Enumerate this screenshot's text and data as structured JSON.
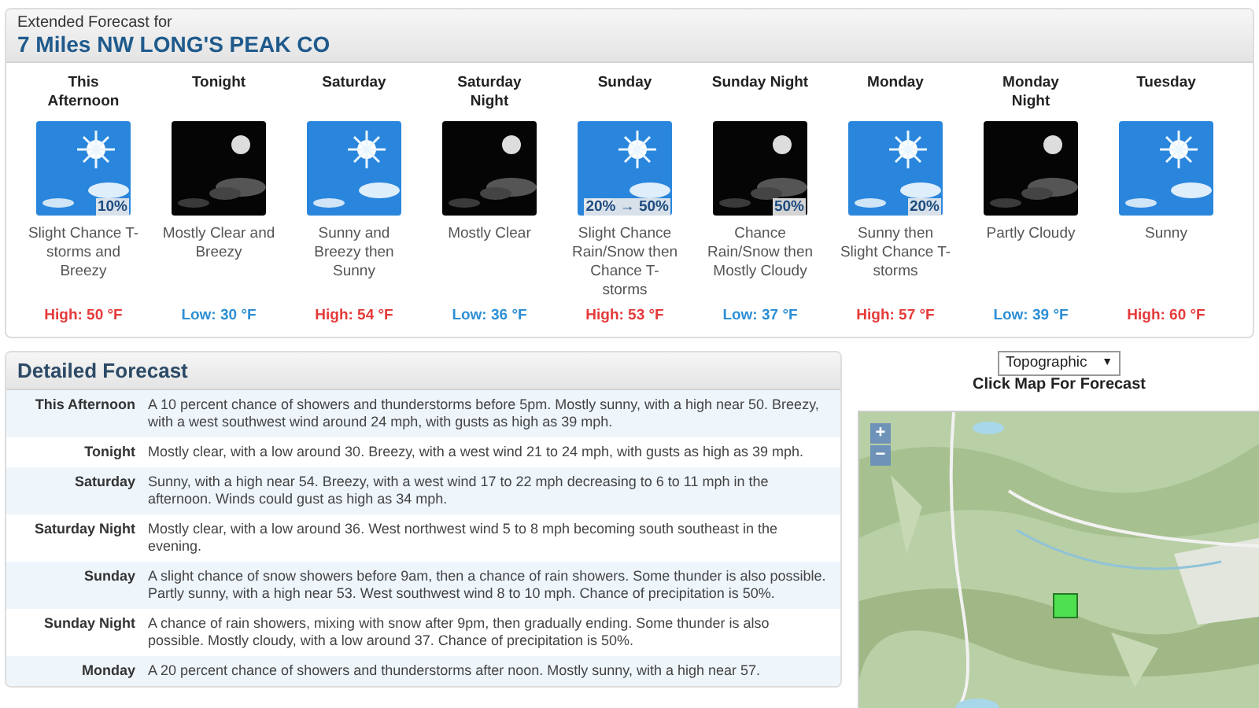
{
  "extended": {
    "caption": "Extended Forecast for",
    "location": "7 Miles NW LONG'S PEAK CO",
    "periods": [
      {
        "name": "This Afternoon",
        "kind": "day",
        "chance": "10%",
        "description": "Slight Chance T-storms and Breezy",
        "temp": "High: 50 °F"
      },
      {
        "name": "Tonight",
        "kind": "night",
        "description": "Mostly Clear and Breezy",
        "temp": "Low: 30 °F"
      },
      {
        "name": "Saturday",
        "kind": "day",
        "description": "Sunny and Breezy then Sunny",
        "temp": "High: 54 °F"
      },
      {
        "name": "Saturday Night",
        "kind": "night",
        "description": "Mostly Clear",
        "temp": "Low: 36 °F"
      },
      {
        "name": "Sunday",
        "kind": "day",
        "chance": "20% → 50%",
        "description": "Slight Chance Rain/Snow then Chance T-storms",
        "temp": "High: 53 °F"
      },
      {
        "name": "Sunday Night",
        "kind": "night",
        "chance": "50%",
        "description": "Chance Rain/Snow then Mostly Cloudy",
        "temp": "Low: 37 °F"
      },
      {
        "name": "Monday",
        "kind": "day",
        "chance": "20%",
        "description": "Sunny then Slight Chance T-storms",
        "temp": "High: 57 °F"
      },
      {
        "name": "Monday Night",
        "kind": "night",
        "description": "Partly Cloudy",
        "temp": "Low: 39 °F"
      },
      {
        "name": "Tuesday",
        "kind": "day",
        "description": "Sunny",
        "temp": "High: 60 °F"
      }
    ]
  },
  "detailed": {
    "title": "Detailed Forecast",
    "rows": [
      {
        "label": "This Afternoon",
        "text": "A 10 percent chance of showers and thunderstorms before 5pm. Mostly sunny, with a high near 50. Breezy, with a west southwest wind around 24 mph, with gusts as high as 39 mph."
      },
      {
        "label": "Tonight",
        "text": "Mostly clear, with a low around 30. Breezy, with a west wind 21 to 24 mph, with gusts as high as 39 mph."
      },
      {
        "label": "Saturday",
        "text": "Sunny, with a high near 54. Breezy, with a west wind 17 to 22 mph decreasing to 6 to 11 mph in the afternoon. Winds could gust as high as 34 mph."
      },
      {
        "label": "Saturday Night",
        "text": "Mostly clear, with a low around 36. West northwest wind 5 to 8 mph becoming south southeast in the evening."
      },
      {
        "label": "Sunday",
        "text": "A slight chance of snow showers before 9am, then a chance of rain showers. Some thunder is also possible. Partly sunny, with a high near 53. West southwest wind 8 to 10 mph. Chance of precipitation is 50%."
      },
      {
        "label": "Sunday Night",
        "text": "A chance of rain showers, mixing with snow after 9pm, then gradually ending. Some thunder is also possible. Mostly cloudy, with a low around 37. Chance of precipitation is 50%."
      },
      {
        "label": "Monday",
        "text": "A 20 percent chance of showers and thunderstorms after noon. Mostly sunny, with a high near 57."
      }
    ]
  },
  "map": {
    "layer": "Topographic",
    "caret": "▼",
    "caption": "Click Map For Forecast",
    "zoom_in": "+",
    "zoom_out": "−",
    "kind": "picture"
  }
}
